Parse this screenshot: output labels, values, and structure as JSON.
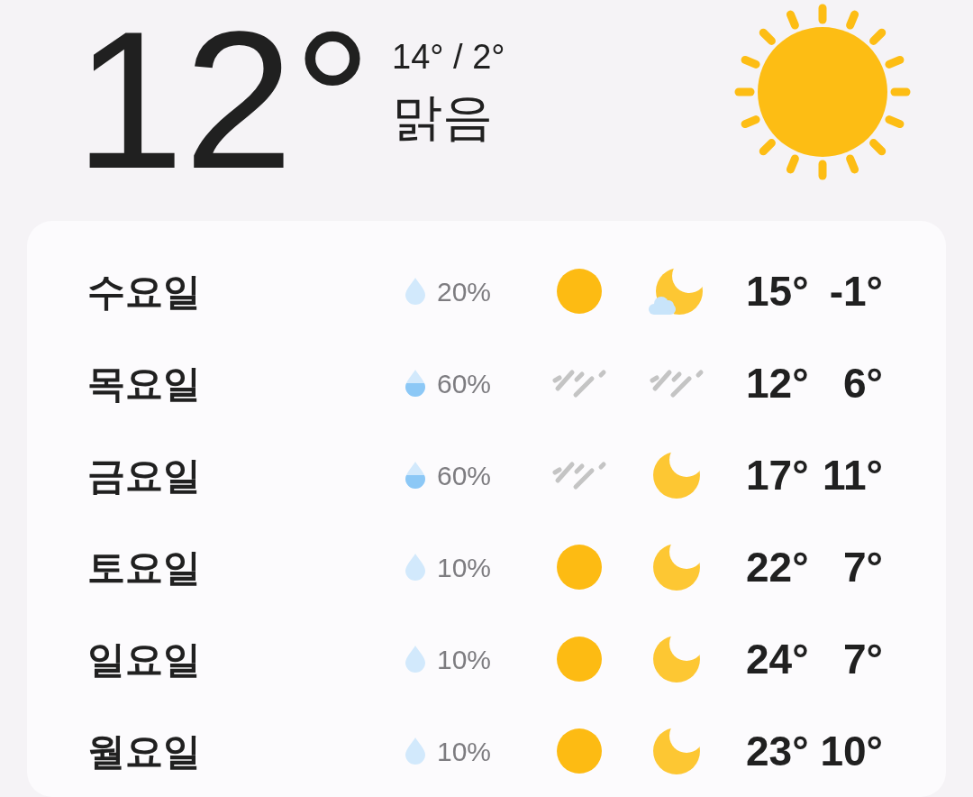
{
  "current": {
    "temperature": "12°",
    "range": "14° / 2°",
    "condition": "맑음",
    "icon": {
      "kind": "sun"
    }
  },
  "forecast": [
    {
      "day": "수요일",
      "precipitation": {
        "text": "20%",
        "kind": "empty"
      },
      "day_icon": {
        "kind": "sun"
      },
      "night_icon": {
        "kind": "moon_cloud"
      },
      "high": "15°",
      "low": "-1°"
    },
    {
      "day": "목요일",
      "precipitation": {
        "text": "60%",
        "kind": "half"
      },
      "day_icon": {
        "kind": "rain"
      },
      "night_icon": {
        "kind": "rain"
      },
      "high": "12°",
      "low": "6°"
    },
    {
      "day": "금요일",
      "precipitation": {
        "text": "60%",
        "kind": "half"
      },
      "day_icon": {
        "kind": "rain"
      },
      "night_icon": {
        "kind": "moon"
      },
      "high": "17°",
      "low": "11°"
    },
    {
      "day": "토요일",
      "precipitation": {
        "text": "10%",
        "kind": "empty"
      },
      "day_icon": {
        "kind": "sun"
      },
      "night_icon": {
        "kind": "moon"
      },
      "high": "22°",
      "low": "7°"
    },
    {
      "day": "일요일",
      "precipitation": {
        "text": "10%",
        "kind": "empty"
      },
      "day_icon": {
        "kind": "sun"
      },
      "night_icon": {
        "kind": "moon"
      },
      "high": "24°",
      "low": "7°"
    },
    {
      "day": "월요일",
      "precipitation": {
        "text": "10%",
        "kind": "empty"
      },
      "day_icon": {
        "kind": "sun"
      },
      "night_icon": {
        "kind": "moon"
      },
      "high": "23°",
      "low": "10°"
    }
  ]
}
